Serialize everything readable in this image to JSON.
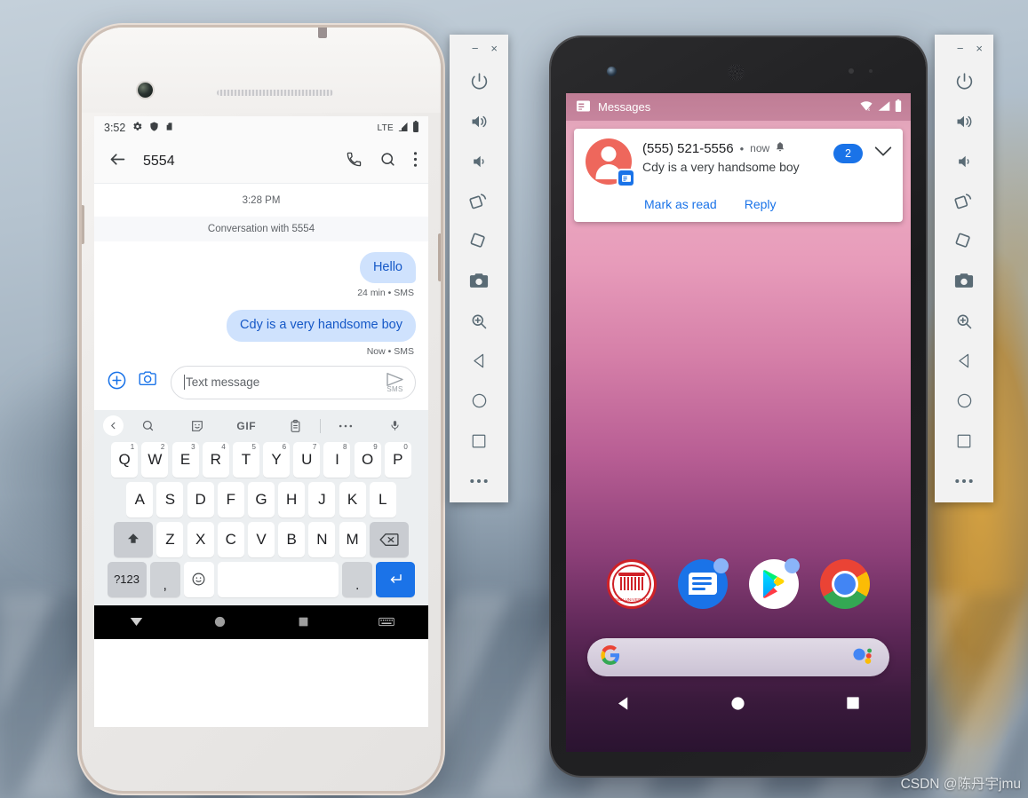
{
  "phone1": {
    "device_name": "white-android-emulator-device",
    "status_bar": {
      "time": "3:52",
      "network": "LTE",
      "icons": [
        "gear-icon",
        "shield-icon",
        "sim-card-icon",
        "signal-icon",
        "battery-icon"
      ]
    },
    "app_bar": {
      "title": "5554",
      "back": "back-arrow-icon",
      "actions": [
        "phone-call-icon",
        "search-icon",
        "overflow-menu-icon"
      ]
    },
    "conversation": {
      "day_stamp": "3:28 PM",
      "header": "Conversation with 5554",
      "messages": [
        {
          "text": "Hello",
          "meta": "24 min • SMS",
          "side": "outgoing"
        },
        {
          "text": "Cdy is a very handsome boy",
          "meta": "Now • SMS",
          "side": "outgoing"
        }
      ]
    },
    "composer": {
      "placeholder": "Text message",
      "value": "",
      "send_label": "SMS",
      "attach": "plus-circle-icon",
      "camera": "camera-icon",
      "send": "send-icon"
    },
    "keyboard": {
      "toolbar": [
        "chevron-left-icon",
        "search-icon",
        "sticker-icon",
        "GIF",
        "clipboard-icon",
        "more-icon",
        "mic-icon"
      ],
      "gif_label": "GIF",
      "row1": [
        {
          "k": "Q",
          "n": "1"
        },
        {
          "k": "W",
          "n": "2"
        },
        {
          "k": "E",
          "n": "3"
        },
        {
          "k": "R",
          "n": "4"
        },
        {
          "k": "T",
          "n": "5"
        },
        {
          "k": "Y",
          "n": "6"
        },
        {
          "k": "U",
          "n": "7"
        },
        {
          "k": "I",
          "n": "8"
        },
        {
          "k": "O",
          "n": "9"
        },
        {
          "k": "P",
          "n": "0"
        }
      ],
      "row2": [
        "A",
        "S",
        "D",
        "F",
        "G",
        "H",
        "J",
        "K",
        "L"
      ],
      "row3": [
        "Z",
        "X",
        "C",
        "V",
        "B",
        "N",
        "M"
      ],
      "shift": "shift-icon",
      "backspace": "backspace-icon",
      "numeric": "?123",
      "comma": ",",
      "emoji": "emoji-icon",
      "space": "",
      "period": ".",
      "enter": "enter-icon"
    },
    "nav_bar": [
      "collapse-keyboard-icon",
      "home-circle-icon",
      "recents-square-icon",
      "keyboard-icon"
    ]
  },
  "phone2": {
    "device_name": "black-android-emulator-device",
    "status_bar": {
      "app": "Messages",
      "app_icon": "messages-icon",
      "icons": [
        "wifi-off-icon",
        "signal-icon",
        "battery-icon"
      ]
    },
    "notification": {
      "avatar": "contact-avatar",
      "avatar_badge": "messages-badge-icon",
      "sender": "(555) 521-5556",
      "separator": "•",
      "time": "now",
      "alert_icon": "bell-icon",
      "body": "Cdy is a very handsome boy",
      "count_badge": "2",
      "expand": "chevron-down-icon",
      "actions": [
        {
          "label": "Mark as read",
          "name": "mark-as-read-action"
        },
        {
          "label": "Reply",
          "name": "reply-action"
        }
      ]
    },
    "home": {
      "apps": [
        {
          "name": "app-icon-university",
          "label": "JIMEI UNIVERSITY"
        },
        {
          "name": "app-icon-messages",
          "label": "Messages"
        },
        {
          "name": "app-icon-play-store",
          "label": "Play Store"
        },
        {
          "name": "app-icon-chrome",
          "label": "Chrome"
        }
      ],
      "search_bar": {
        "logo": "google-g-icon",
        "assistant": "google-assistant-icon",
        "value": ""
      }
    },
    "nav_bar": [
      "back-triangle-icon",
      "home-circle-icon",
      "recents-square-icon"
    ]
  },
  "emulator_toolbar": {
    "window_minimize": "−",
    "window_close": "×",
    "buttons": [
      {
        "name": "power-button",
        "icon": "power-icon"
      },
      {
        "name": "volume-up-button",
        "icon": "volume-up-icon"
      },
      {
        "name": "volume-down-button",
        "icon": "volume-down-icon"
      },
      {
        "name": "rotate-left-button",
        "icon": "rotate-left-icon"
      },
      {
        "name": "rotate-right-button",
        "icon": "rotate-right-icon"
      },
      {
        "name": "screenshot-button",
        "icon": "camera-icon"
      },
      {
        "name": "zoom-button",
        "icon": "zoom-in-icon"
      },
      {
        "name": "back-button",
        "icon": "back-triangle-icon"
      },
      {
        "name": "home-button",
        "icon": "home-circle-icon"
      },
      {
        "name": "overview-button",
        "icon": "recents-square-icon"
      },
      {
        "name": "more-button",
        "icon": "ellipsis-icon"
      }
    ]
  },
  "watermark": "CSDN @陈丹宇jmu",
  "colors": {
    "accent_blue": "#1a73e8",
    "bubble_bg": "#cfe2fd",
    "bubble_text": "#1558c7",
    "avatar_red": "#ee675c",
    "toolbar_bg": "#f2f2f2",
    "toolbar_icon": "#5a6b75",
    "status_bar_pink": "#be7c94"
  }
}
